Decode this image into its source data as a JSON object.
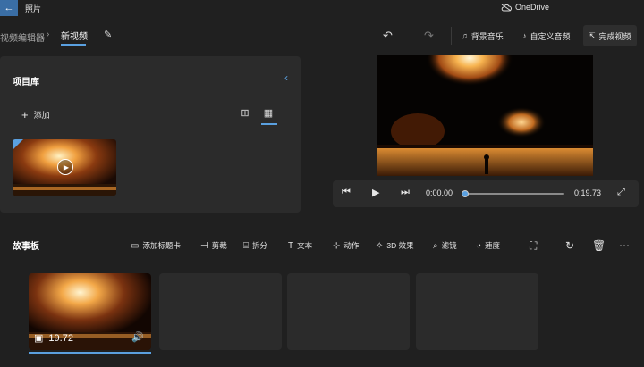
{
  "app": {
    "title": "照片",
    "onedrive": "OneDrive"
  },
  "breadcrumb": {
    "parent": "视频编辑器",
    "current": "新视频"
  },
  "toolbar": {
    "background_music": "背景音乐",
    "custom_audio": "自定义音频",
    "finish_video": "完成视频"
  },
  "library": {
    "title": "项目库",
    "add_label": "添加"
  },
  "player": {
    "current_time": "0:00.00",
    "total_time": "0:19.73",
    "progress": 0
  },
  "storyboard": {
    "title": "故事板",
    "actions": [
      {
        "label": "添加标题卡",
        "icon": "title-card-icon"
      },
      {
        "label": "剪裁",
        "icon": "trim-icon"
      },
      {
        "label": "拆分",
        "icon": "split-icon"
      },
      {
        "label": "文本",
        "icon": "text-icon"
      },
      {
        "label": "动作",
        "icon": "motion-icon"
      },
      {
        "label": "3D 效果",
        "icon": "3d-effects-icon"
      },
      {
        "label": "滤镜",
        "icon": "filter-icon"
      },
      {
        "label": "速度",
        "icon": "speed-icon"
      }
    ],
    "clips": [
      {
        "duration": "19.72"
      }
    ]
  },
  "colors": {
    "accent": "#5aa0e0",
    "background": "#202020",
    "panel": "#2b2b2b"
  }
}
